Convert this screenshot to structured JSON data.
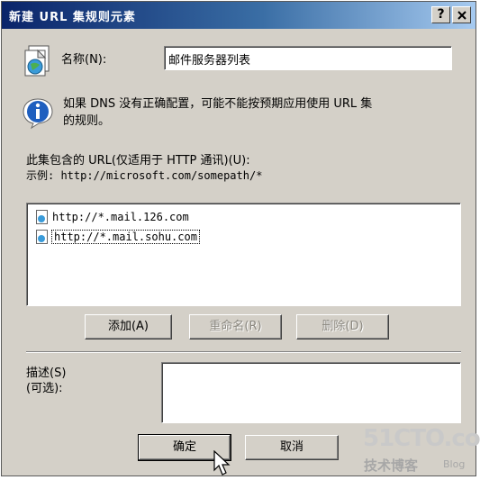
{
  "dialog": {
    "title": "新建 URL 集规则元素",
    "help_button": "?",
    "close_button": "✕"
  },
  "name_field": {
    "label": "名称(N):",
    "value": "邮件服务器列表"
  },
  "info": {
    "line1": "如果 DNS 没有正确配置，可能不能按预期应用使用 URL 集",
    "line2": "的规则。"
  },
  "url_section": {
    "label": "此集包含的 URL(仅适用于 HTTP 通讯)(U):",
    "example": "示例: http://microsoft.com/somepath/*",
    "urls": [
      "http://*.mail.126.com",
      "http://*.mail.sohu.com"
    ]
  },
  "list_buttons": {
    "add": "添加(A)",
    "rename": "重命名(R)",
    "delete": "删除(D)"
  },
  "description": {
    "label1": "描述(S)",
    "label2": "(可选):",
    "value": ""
  },
  "footer": {
    "ok": "确定",
    "cancel": "取消"
  },
  "watermark": {
    "brand": "51CTO.com",
    "sub": "技术博客",
    "blog": "Blog"
  }
}
